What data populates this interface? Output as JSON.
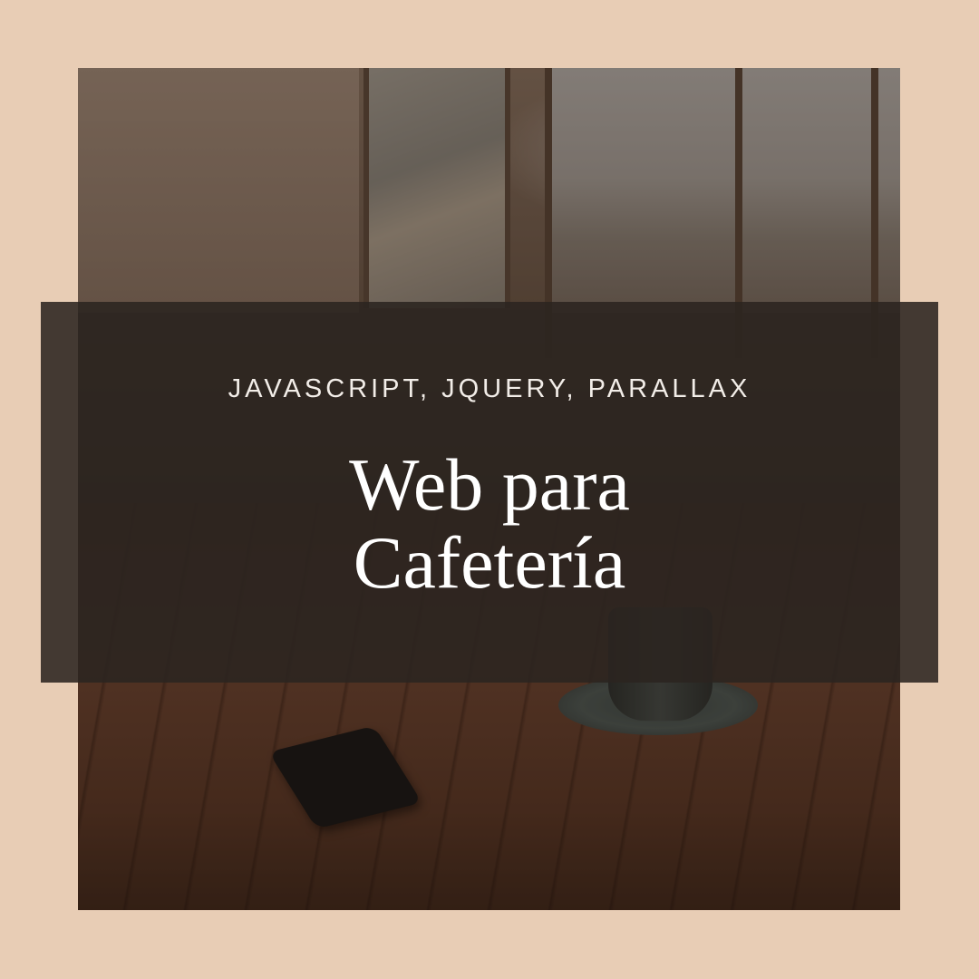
{
  "banner": {
    "tags": "JAVASCRIPT, JQUERY, PARALLAX",
    "title_line1": "Web para",
    "title_line2": "Cafetería"
  },
  "colors": {
    "background": "#e8cdb5",
    "banner": "#2b2420",
    "text": "#ffffff"
  }
}
